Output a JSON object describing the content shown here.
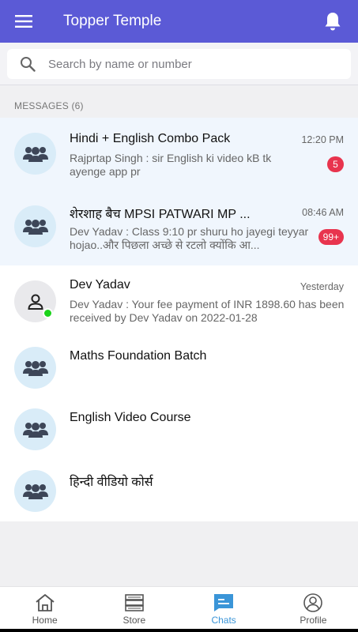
{
  "app": {
    "title": "Topper Temple"
  },
  "search": {
    "placeholder": "Search by name or number"
  },
  "section": {
    "header": "MESSAGES (6)"
  },
  "chats": [
    {
      "name": "Hindi + English Combo Pack",
      "time": "12:20 PM",
      "preview": "Rajprtap Singh :  sir English ki video kB tk ayenge app pr",
      "badge": "5",
      "unread": true,
      "avatar": "group-icon"
    },
    {
      "name": "शेरशाह बैच MPSI PATWARI MP ...",
      "time": "08:46 AM",
      "preview": "Dev Yadav :  Class 9:10 pr shuru ho jayegi teyyar hojao..और पिछला अच्छे से रटलो क्योंकि आ...",
      "badge": "99+",
      "unread": true,
      "avatar": "group-icon"
    },
    {
      "name": "Dev Yadav",
      "time": "Yesterday",
      "preview": "Dev Yadav :  Your fee payment of INR 1898.60 has been received by Dev Yadav on 2022-01-28",
      "badge": "",
      "unread": false,
      "avatar": "user-icon",
      "online": true
    },
    {
      "name": "Maths Foundation Batch",
      "time": "",
      "preview": "",
      "badge": "",
      "unread": false,
      "avatar": "group-icon"
    },
    {
      "name": "English Video Course",
      "time": "",
      "preview": "",
      "badge": "",
      "unread": false,
      "avatar": "group-icon"
    },
    {
      "name": "हिन्दी वीडियो कोर्स",
      "time": "",
      "preview": "",
      "badge": "",
      "unread": false,
      "avatar": "group-icon"
    }
  ],
  "nav": [
    {
      "label": "Home",
      "icon": "home-icon",
      "active": false
    },
    {
      "label": "Store",
      "icon": "store-icon",
      "active": false
    },
    {
      "label": "Chats",
      "icon": "chat-icon",
      "active": true
    },
    {
      "label": "Profile",
      "icon": "profile-icon",
      "active": false
    }
  ],
  "colors": {
    "appbar": "#5b5ad6",
    "badge": "#e8344e",
    "active_nav": "#3a95d8",
    "online": "#1bd31b"
  }
}
